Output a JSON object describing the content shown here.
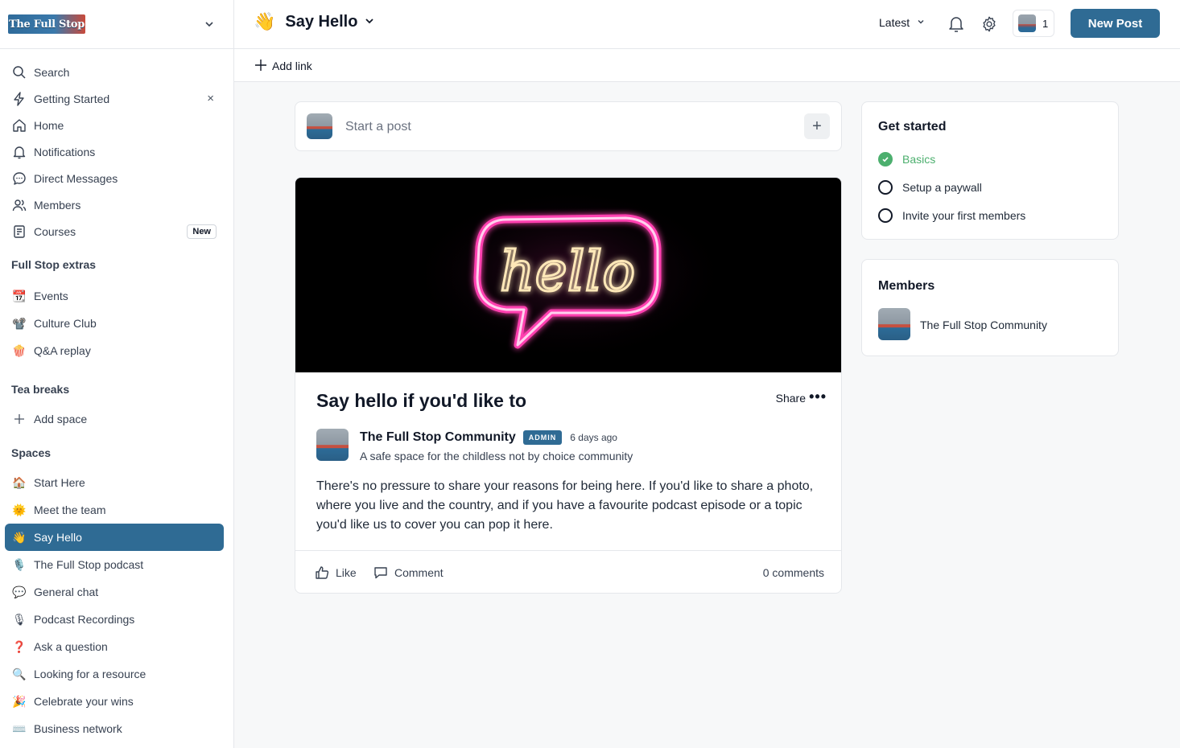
{
  "sidebar": {
    "logo_text": "The Full Stop",
    "nav": [
      {
        "label": "Search",
        "icon": "search-icon"
      },
      {
        "label": "Getting Started",
        "icon": "bolt-icon",
        "dismiss": "×"
      },
      {
        "label": "Home",
        "icon": "home-icon"
      },
      {
        "label": "Notifications",
        "icon": "bell-icon"
      },
      {
        "label": "Direct Messages",
        "icon": "chat-icon"
      },
      {
        "label": "Members",
        "icon": "members-icon"
      },
      {
        "label": "Courses",
        "icon": "courses-icon",
        "badge": "New"
      }
    ],
    "extras_title": "Full Stop extras",
    "extras": [
      {
        "label": "Events",
        "emoji": "📆"
      },
      {
        "label": "Culture Club",
        "emoji": "📽️"
      },
      {
        "label": "Q&A replay",
        "emoji": "🍿"
      }
    ],
    "tea_title": "Tea breaks",
    "add_space": "Add space",
    "spaces_title": "Spaces",
    "spaces": [
      {
        "label": "Start Here",
        "emoji": "🏠"
      },
      {
        "label": "Meet the team",
        "emoji": "🌞"
      },
      {
        "label": "Say Hello",
        "emoji": "👋",
        "active": true
      },
      {
        "label": "The Full Stop podcast",
        "emoji": "🎙️"
      },
      {
        "label": "General chat",
        "emoji": "💬"
      },
      {
        "label": "Podcast Recordings",
        "emoji": "🎙"
      },
      {
        "label": "Ask a question",
        "emoji": "❓"
      },
      {
        "label": "Looking for a resource",
        "emoji": "🔍"
      },
      {
        "label": "Celebrate your wins",
        "emoji": "🎉"
      },
      {
        "label": "Business network",
        "emoji": "⌨️"
      }
    ]
  },
  "topbar": {
    "space_emoji": "👋",
    "space_title": "Say Hello",
    "sort_label": "Latest",
    "user_count": "1",
    "new_post_label": "New Post"
  },
  "subbar": {
    "add_link_label": "Add link"
  },
  "composer": {
    "placeholder": "Start a post",
    "plus": "+"
  },
  "post": {
    "cover_text": "hello",
    "title": "Say hello if you'd like to",
    "share_label": "Share",
    "more": "•••",
    "author": "The Full Stop Community",
    "author_badge": "ADMIN",
    "time_ago": "6 days ago",
    "tagline": "A safe space for the childless not by choice community",
    "body": "There's no pressure to share your reasons for being here. If you'd like to share a photo, where you live and the country, and if you have a favourite podcast episode or a topic you'd like us to cover you can pop it here.",
    "like_label": "Like",
    "comment_label": "Comment",
    "comments_count": "0 comments"
  },
  "get_started": {
    "title": "Get started",
    "items": [
      {
        "label": "Basics",
        "done": true
      },
      {
        "label": "Setup a paywall",
        "done": false
      },
      {
        "label": "Invite your first members",
        "done": false
      }
    ]
  },
  "members": {
    "title": "Members",
    "items": [
      {
        "name": "The Full Stop Community"
      }
    ]
  },
  "colors": {
    "accent": "#2f6b94",
    "success": "#4caf6e",
    "neon": "#ff3fb0"
  }
}
